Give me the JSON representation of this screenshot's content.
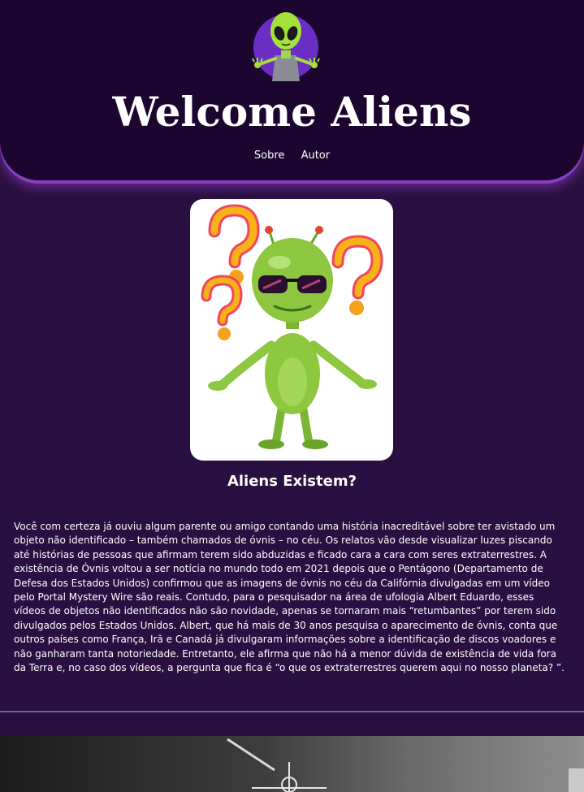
{
  "header": {
    "logo_icon": "alien-logo-icon",
    "title": "Welcome Aliens",
    "nav": [
      {
        "label": "Sobre"
      },
      {
        "label": "Autor"
      }
    ]
  },
  "main": {
    "hero_image_icon": "alien-with-question-marks-illustration",
    "section_title": "Aliens Existem?",
    "paragraph": "Você com certeza já ouviu algum parente ou amigo contando uma história inacreditável sobre ter avistado um objeto não identificado – também chamados de óvnis – no céu. Os relatos vão desde visualizar luzes piscando até histórias de pessoas que afirmam terem sido abduzidas e ficado cara a cara com seres extraterrestres. A existência de Óvnis voltou a ser notícia no mundo todo em 2021 depois que o Pentágono (Departamento de Defesa dos Estados Unidos) confirmou que as imagens de óvnis no céu da Califórnia divulgadas em um vídeo pelo Portal Mystery Wire são reais. Contudo, para o pesquisador na área de ufologia Albert Eduardo, esses vídeos de objetos não identificados não são novidade, apenas se tornaram mais “retumbantes” por terem sido divulgados pelos Estados Unidos. Albert, que há mais de 30 anos pesquisa o aparecimento de óvnis, conta que outros países como França, Irã e Canadá já divulgaram informações sobre a identificação de discos voadores e não ganharam tanta notoriedade. Entretanto, ele afirma que não há a menor dúvida de existência de vida fora da Terra e, no caso dos vídeos, a pergunta que fica é “o que os extraterrestres querem aqui no nosso planeta? ”."
  },
  "colors": {
    "page_bg": "#2a1040",
    "header_bg": "#1c0630",
    "header_glow": "#8a3fc2",
    "alien_green": "#8dc63f",
    "question_mark": "#f7a21b"
  }
}
